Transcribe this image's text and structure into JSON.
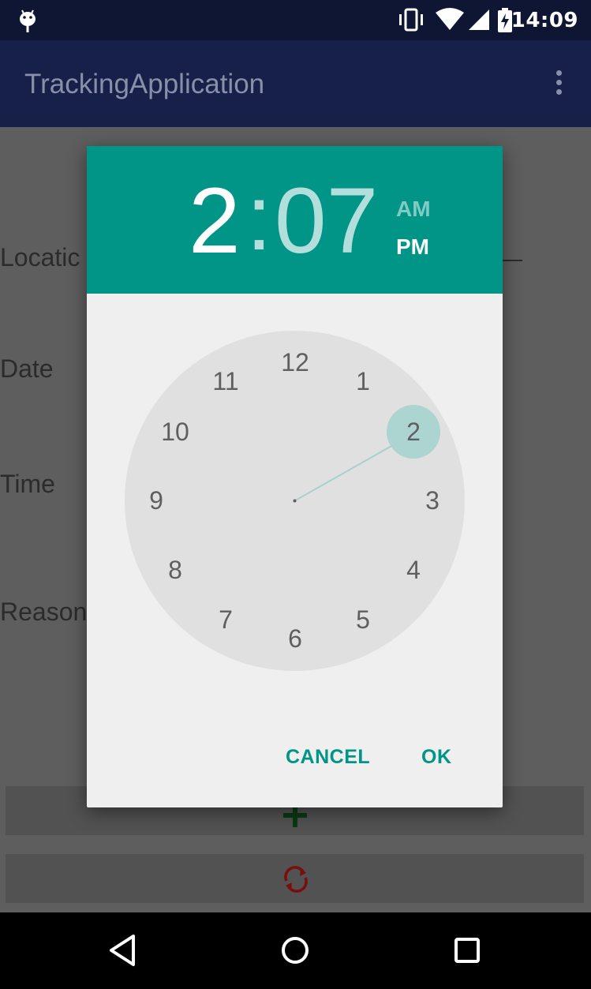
{
  "status_bar": {
    "time": "14:09",
    "icons": [
      "android-debug-icon",
      "vibrate-icon",
      "wifi-icon",
      "signal-icon",
      "battery-charging-icon"
    ]
  },
  "app_bar": {
    "title": "TrackingApplication",
    "overflow_icon": "more-vert-icon"
  },
  "form": {
    "location_label": "Locatic",
    "date_label": "Date",
    "time_label": "Time",
    "reason_label": "Reason",
    "add_button_icon": "plus-icon",
    "sync_button_icon": "sync-icon"
  },
  "time_picker": {
    "hour": "2",
    "separator": ":",
    "minute": "07",
    "am_label": "AM",
    "pm_label": "PM",
    "selected_period": "PM",
    "clock_numbers": [
      "12",
      "1",
      "2",
      "3",
      "4",
      "5",
      "6",
      "7",
      "8",
      "9",
      "10",
      "11"
    ],
    "selected_hour": "2",
    "cancel_label": "CANCEL",
    "ok_label": "OK",
    "colors": {
      "header": "#009587",
      "accent": "#009587",
      "selection": "#acd4d0",
      "clock_face": "#e0e0e0"
    }
  },
  "nav_bar": {
    "icons": [
      "back-icon",
      "home-icon",
      "recents-icon"
    ]
  }
}
